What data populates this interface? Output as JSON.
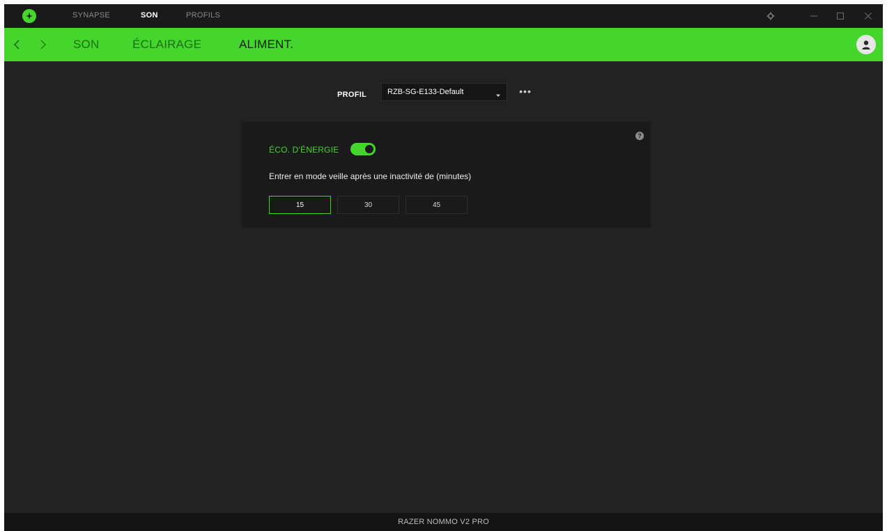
{
  "colors": {
    "accent": "#44d62c",
    "background": "#222222",
    "titlebar": "#1a1a1a",
    "panel": "#1a1a1a"
  },
  "titlebar": {
    "logo_icon": "razer-logo-icon",
    "tabs": [
      {
        "label": "SYNAPSE",
        "active": false
      },
      {
        "label": "SON",
        "active": true
      },
      {
        "label": "PROFILS",
        "active": false
      }
    ],
    "controls": [
      "gear-icon",
      "minimize-icon",
      "maximize-icon",
      "close-icon"
    ]
  },
  "navbar": {
    "back_icon": "chevron-left-icon",
    "forward_icon": "chevron-right-icon",
    "tabs": [
      {
        "label": "SON",
        "active": false
      },
      {
        "label": "ÉCLAIRAGE",
        "active": false
      },
      {
        "label": "ALIMENT.",
        "active": true
      }
    ],
    "avatar_icon": "user-avatar-icon"
  },
  "profile": {
    "label": "PROFIL",
    "selected": "RZB-SG-E133-Default",
    "more": "•••"
  },
  "power": {
    "eco_label": "ÉCO. D'ÉNERGIE",
    "eco_enabled": true,
    "sleep_text": "Entrer en mode veille après une inactivité de (minutes)",
    "options": [
      "15",
      "30",
      "45"
    ],
    "selected_option": "15",
    "help": "?"
  },
  "footer": {
    "device_name": "RAZER NOMMO V2 PRO"
  }
}
